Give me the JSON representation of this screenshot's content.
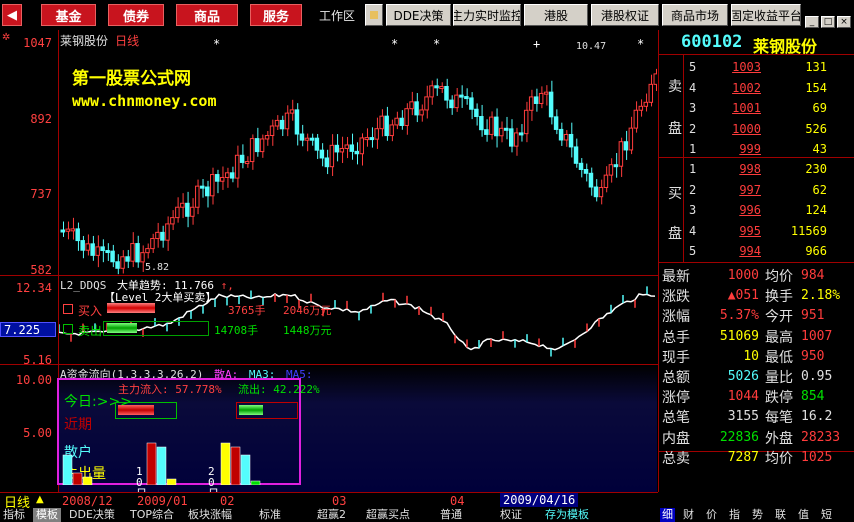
{
  "toolbar": {
    "buttons": [
      "基金",
      "债券",
      "商品",
      "服务"
    ],
    "workspace": "工作区",
    "gray_buttons": [
      "DDE决策",
      "主力实时监控",
      "港股",
      "港股权证",
      "商品市场",
      "固定收益平台"
    ],
    "window_controls": [
      "minimize-icon",
      "restore-icon",
      "close-icon"
    ]
  },
  "chart": {
    "title": "莱钢股份",
    "period": "日线",
    "watermark_name": "第一股票公式网",
    "watermark_url": "www.chnmoney.com",
    "price_axis": [
      "1047",
      "892",
      "737",
      "582"
    ],
    "high_label": "10.47",
    "low_label": "5.82",
    "star_marks": [
      "*",
      "*",
      "*",
      "+",
      "*"
    ]
  },
  "ddqs": {
    "header": "L2_DDQS",
    "header_big_trend": "大单趋势: 11.766",
    "header_level2": "【Level_2大单买卖】",
    "axis": [
      "12.34",
      "7.225",
      "5.16"
    ],
    "buy_label": "买入",
    "sell_label": "卖出",
    "buy_volume": "3765手",
    "buy_amount": "2046万元",
    "sell_volume": "14708手",
    "sell_amount": "1448万元"
  },
  "capital": {
    "header": "A资金流向(1,3,3,3,26,2)",
    "header_sa": "散A:",
    "header_ma3": "MA3:",
    "header_ma5": "MA5:",
    "axis": [
      "10.00",
      "5.00"
    ],
    "main_in": "主力流入: 57.778%",
    "out": "流出: 42.222%",
    "today": "今日:>>>",
    "recent": "近期",
    "sanhu": "散户",
    "main_out": "主出量",
    "day10": "10日",
    "day20": "20日"
  },
  "dates": [
    "日线",
    "2008/12",
    "2009/01",
    "02",
    "03",
    "04",
    "2009/04/16"
  ],
  "quote": {
    "code": "600102",
    "name": "莱钢股份",
    "sell_label_1": "卖",
    "sell_label_2": "盘",
    "buy_label_1": "买",
    "buy_label_2": "盘",
    "sell": [
      {
        "level": "5",
        "price": "1003",
        "vol": "131"
      },
      {
        "level": "4",
        "price": "1002",
        "vol": "154"
      },
      {
        "level": "3",
        "price": "1001",
        "vol": "69"
      },
      {
        "level": "2",
        "price": "1000",
        "vol": "526"
      },
      {
        "level": "1",
        "price": "999",
        "vol": "43"
      }
    ],
    "buy": [
      {
        "level": "1",
        "price": "998",
        "vol": "230"
      },
      {
        "level": "2",
        "price": "997",
        "vol": "62"
      },
      {
        "level": "3",
        "price": "996",
        "vol": "124"
      },
      {
        "level": "4",
        "price": "995",
        "vol": "11569"
      },
      {
        "level": "5",
        "price": "994",
        "vol": "966"
      }
    ],
    "stats": [
      {
        "l1": "最新",
        "v1": "1000",
        "l2": "均价",
        "v2": "984"
      },
      {
        "l1": "涨跌",
        "v1": "▲051",
        "l2": "换手",
        "v2": "2.18%"
      },
      {
        "l1": "涨幅",
        "v1": "5.37%",
        "l2": "今开",
        "v2": "951"
      },
      {
        "l1": "总手",
        "v1": "51069",
        "l2": "最高",
        "v2": "1007"
      },
      {
        "l1": "现手",
        "v1": "10",
        "l2": "最低",
        "v2": "950"
      },
      {
        "l1": "总额",
        "v1": "5026",
        "l2": "量比",
        "v2": "0.95"
      },
      {
        "l1": "涨停",
        "v1": "1044",
        "l2": "跌停",
        "v2": "854"
      },
      {
        "l1": "总笔",
        "v1": "3155",
        "l2": "每笔",
        "v2": "16.2"
      },
      {
        "l1": "内盘",
        "v1": "22836",
        "l2": "外盘",
        "v2": "28233"
      },
      {
        "l1": "总卖",
        "v1": "7287",
        "l2": "均价",
        "v2": "1025"
      }
    ]
  },
  "tabs": [
    "指标",
    "模板",
    "DDE决策",
    "TOP综合",
    "板块涨幅",
    "标准",
    "超赢2",
    "超赢买点",
    "普通",
    "权证",
    "存为模板"
  ],
  "right_tabs": [
    "细",
    "财",
    "价",
    "指",
    "势",
    "联",
    "值",
    "短"
  ],
  "colors": {
    "red": "#ff3c3c",
    "green": "#00e000",
    "cyan": "#54fcfc",
    "yellow": "#ffff00",
    "accent_blue": "#00ffff"
  }
}
